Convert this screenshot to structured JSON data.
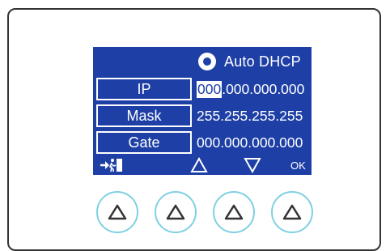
{
  "dhcp": {
    "label": "Auto DHCP",
    "selected": true
  },
  "fields": [
    {
      "label": "IP",
      "value_selected": "000",
      "value_rest": ".000.000.000"
    },
    {
      "label": "Mask",
      "value": "255.255.255.255"
    },
    {
      "label": "Gate",
      "value": "000.000.000.000"
    }
  ],
  "softkeys": {
    "exit_icon": "exit-door-icon",
    "up_icon": "up-triangle-icon",
    "down_icon": "down-triangle-icon",
    "ok_label": "OK"
  },
  "buttons": [
    {
      "icon": "up-triangle-icon"
    },
    {
      "icon": "up-triangle-icon"
    },
    {
      "icon": "up-triangle-icon"
    },
    {
      "icon": "up-triangle-icon"
    }
  ],
  "colors": {
    "screen": "#1e40a6",
    "button_ring": "#7fd0e3",
    "icon": "#333333"
  }
}
